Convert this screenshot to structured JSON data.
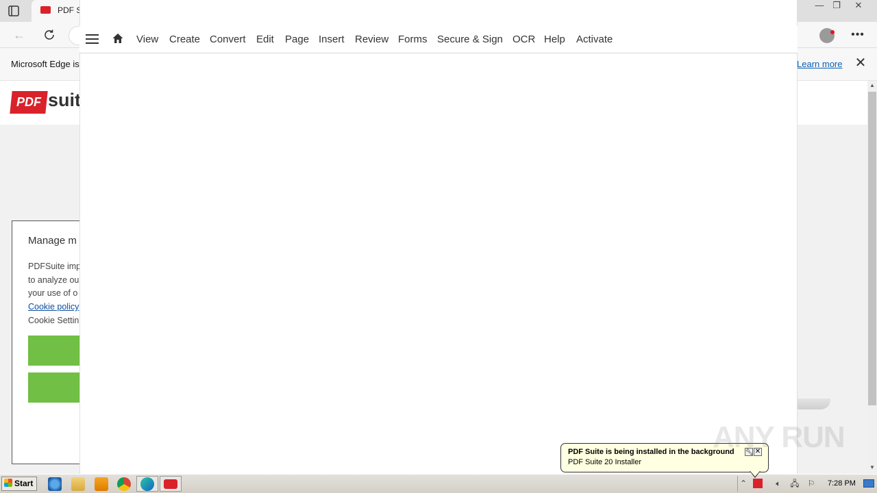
{
  "browser": {
    "tab_title": "PDF S",
    "window_controls": {
      "minimize": "—",
      "restore": "❐",
      "close": "✕"
    },
    "infobar_text": "Microsoft Edge is",
    "learn_more": "Learn more",
    "infobar_close": "✕"
  },
  "site": {
    "logo_pdf": "PDF",
    "logo_suite": "suit"
  },
  "cookie_dialog": {
    "title": "Manage m",
    "lines": [
      "PDFSuite imp",
      "to analyze ou",
      "your use of o"
    ],
    "policy_link": "Cookie policy",
    "settings_line": "Cookie Settin"
  },
  "app": {
    "menu": [
      "View",
      "Create",
      "Convert",
      "Edit",
      "Page",
      "Insert",
      "Review",
      "Forms",
      "Secure & Sign",
      "OCR",
      "Help",
      "Activate"
    ]
  },
  "taskbar": {
    "start_label": "Start",
    "clock": "7:28 PM"
  },
  "balloon": {
    "title": "PDF Suite is being installed in the background",
    "body": "PDF Suite 20 Installer"
  },
  "watermark": "ANY RUN",
  "colors": {
    "brand_red": "#d9222a",
    "cookie_green": "#71bf44",
    "link_blue": "#0a5fb4",
    "balloon_bg": "#ffffe1"
  }
}
